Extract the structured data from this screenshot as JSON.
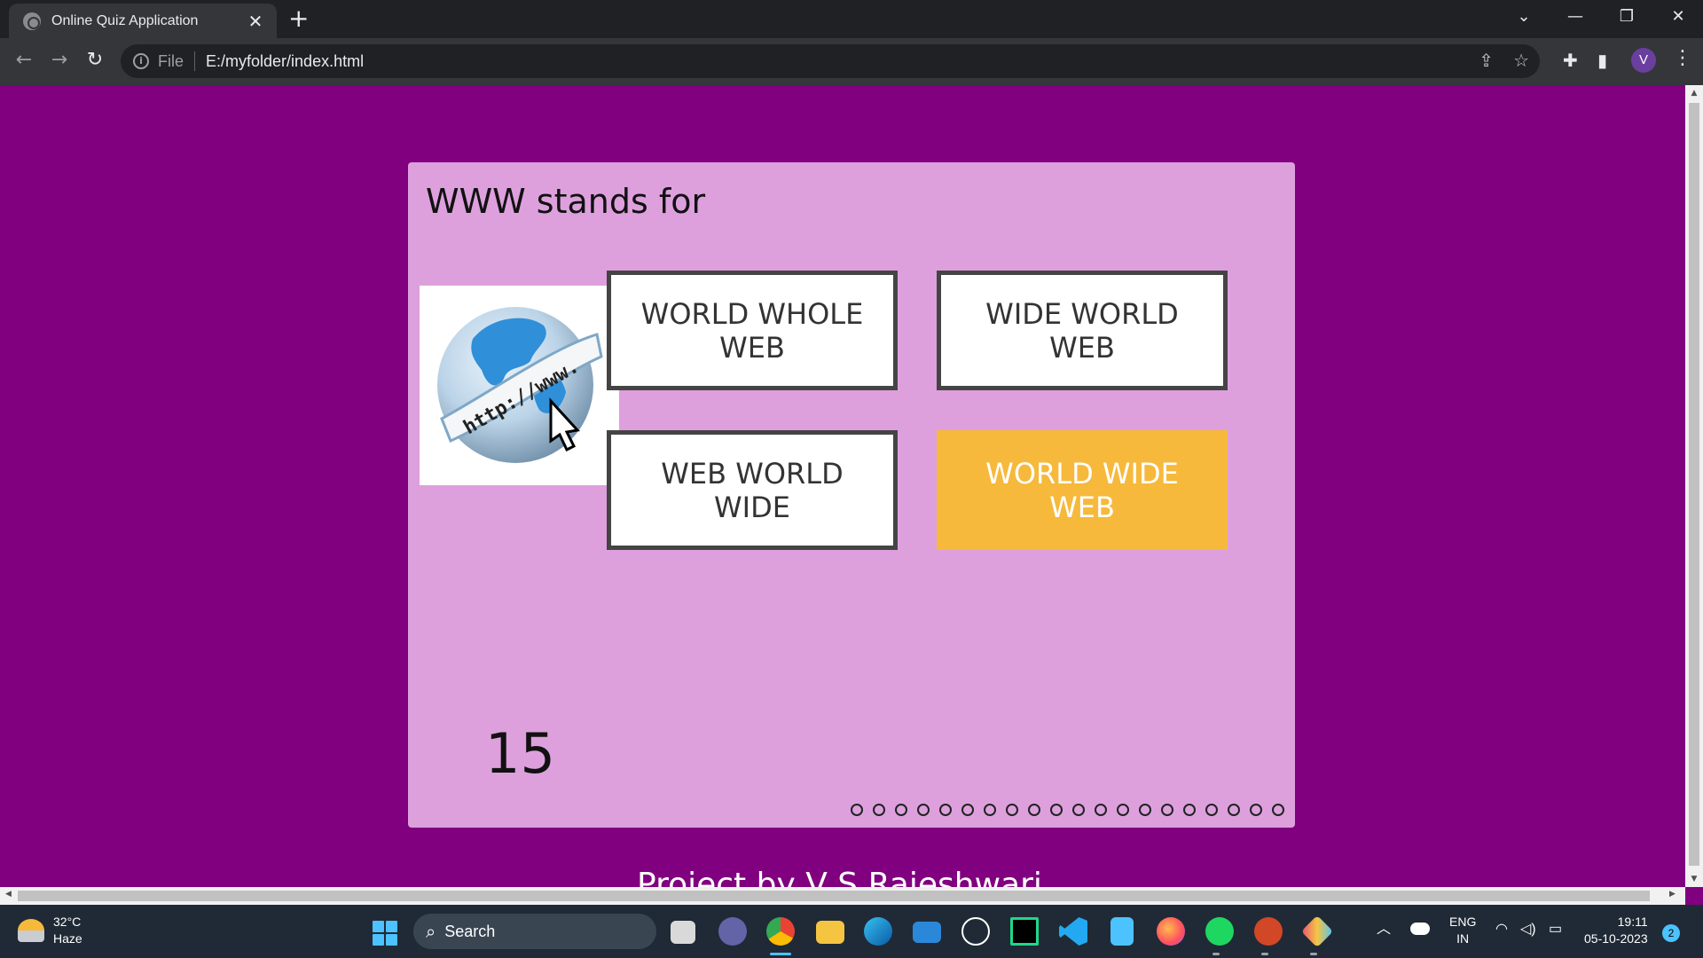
{
  "browser": {
    "tab_title": "Online Quiz Application",
    "tab_close": "✕",
    "new_tab": "+",
    "scheme_label": "File",
    "url": "E:/myfolder/index.html",
    "profile_initial": "V",
    "window_controls": [
      "⌄",
      "—",
      "❐",
      "✕"
    ]
  },
  "quiz": {
    "question": "WWW stands for",
    "image_alt": "globe-with-http-www-ribbon",
    "options": [
      {
        "label": "WORLD WHOLE WEB",
        "state": "normal"
      },
      {
        "label": "WIDE WORLD WEB",
        "state": "normal"
      },
      {
        "label": "WEB WORLD WIDE",
        "state": "normal"
      },
      {
        "label": "WORLD WIDE WEB",
        "state": "correct"
      }
    ],
    "timer": "15",
    "progress_dots": 20,
    "colors": {
      "page_bg": "#800080",
      "card_bg": "#dda0dd",
      "correct": "#f6b93b"
    }
  },
  "footer": {
    "text": "Project by V S Rajeshwari"
  },
  "taskbar": {
    "weather_temp": "32°C",
    "weather_desc": "Haze",
    "search_label": "Search",
    "language_line1": "ENG",
    "language_line2": "IN",
    "time": "19:11",
    "date": "05-10-2023",
    "notification_count": "2"
  }
}
